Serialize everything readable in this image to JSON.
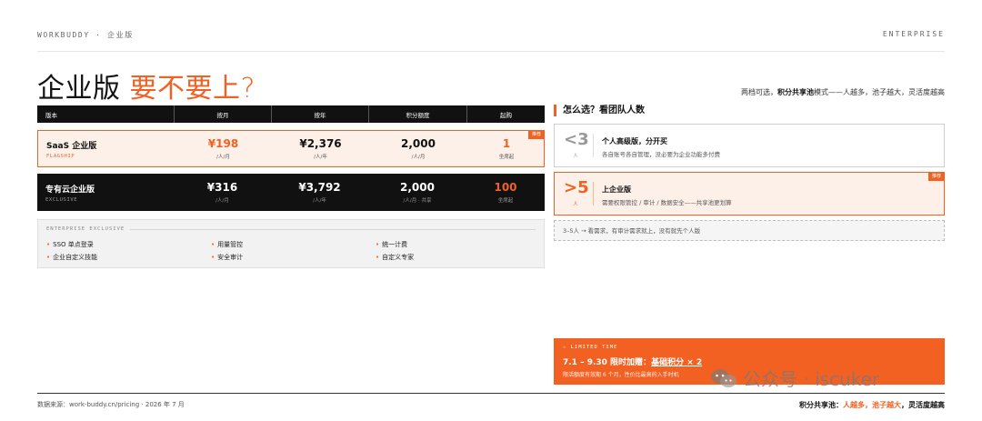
{
  "header": {
    "brand": "WORKBUDDY · 企业版",
    "tag": "ENTERPRISE"
  },
  "title": {
    "main": "企业版",
    "accent": "要不要上?"
  },
  "subtitle": {
    "pre": "两档可选，",
    "bold": "积分共享池",
    "post": "模式——人越多，池子越大，灵活度越高"
  },
  "table": {
    "headers": [
      "版本",
      "按月",
      "按年",
      "积分额度",
      "起购"
    ],
    "rows": [
      {
        "name": "SaaS 企业版",
        "code": "FLAGSHIP",
        "badge": "推荐",
        "monthly": "¥198",
        "monthly_unit": "/人/月",
        "yearly": "¥2,376",
        "yearly_unit": "/人/年",
        "credits": "2,000",
        "credits_unit": "/人/月",
        "min": "1",
        "min_unit": "坐席起"
      },
      {
        "name": "专有云企业版",
        "code": "EXCLUSIVE",
        "monthly": "¥316",
        "monthly_unit": "/人/月",
        "yearly": "¥3,792",
        "yearly_unit": "/人/年",
        "credits": "2,000",
        "credits_unit": "/人/月 · 共享",
        "min": "100",
        "min_unit": "坐席起"
      }
    ]
  },
  "exclusive": {
    "label": "ENTERPRISE EXCLUSIVE",
    "features": [
      "SSO 单点登录",
      "用量管控",
      "统一计费",
      "企业自定义技能",
      "安全审计",
      "自定义专家"
    ]
  },
  "choose": {
    "title": "怎么选？看团队人数",
    "cards": [
      {
        "num": "<3",
        "unit": "人",
        "title": "个人高级版，分开买",
        "desc": "各自账号各自管理，没必要为企业功能多付费"
      },
      {
        "num": ">5",
        "unit": "人",
        "title": "上企业版",
        "desc": "需要权限管控 / 审计 / 数据安全——共享池更划算",
        "badge": "推荐"
      }
    ],
    "note": "3–5人 → 看需求，有审计需求就上，没有就先个人版"
  },
  "promo": {
    "label": "☆ LIMITED TIME",
    "line_pre": "7.1 – 9.30 限时加赠：",
    "line_em": "基础积分 × 2",
    "sub": "限活额度有效期 6 个月，性价比最高的入手时机"
  },
  "watermark": {
    "text": "公众号 · iscuker"
  },
  "footer": {
    "source": "数据来源：work-buddy.cn/pricing · 2026 年 7 月",
    "slogan_pre": "积分共享池：",
    "slogan_em": "人越多，池子越大",
    "slogan_post": "，灵活度越高"
  },
  "colors": {
    "accent": "#f26122",
    "dark": "#111111",
    "tint": "#fdf0e9"
  }
}
